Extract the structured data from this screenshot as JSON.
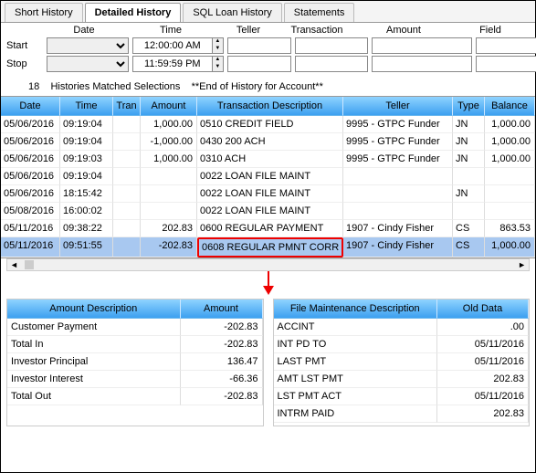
{
  "tabs": [
    {
      "label": "Short History",
      "active": false
    },
    {
      "label": "Detailed History",
      "active": true
    },
    {
      "label": "SQL Loan History",
      "active": false
    },
    {
      "label": "Statements",
      "active": false
    }
  ],
  "filters": {
    "headers": [
      "",
      "Date",
      "Time",
      "Teller",
      "Transaction",
      "Amount",
      "Field"
    ],
    "start_label": "Start",
    "stop_label": "Stop",
    "start_time": "12:00:00 AM",
    "stop_time": "11:59:59 PM"
  },
  "status": {
    "count": "18",
    "text1": "Histories Matched Selections",
    "text2": "**End of History for Account**"
  },
  "grid": {
    "headers": [
      "Date",
      "Time",
      "Tran",
      "Amount",
      "Transaction Description",
      "Teller",
      "Type",
      "Balance"
    ],
    "rows": [
      {
        "date": "05/06/2016",
        "time": "09:19:04",
        "tran": "",
        "amount": "1,000.00",
        "desc": "0510 CREDIT FIELD",
        "teller": "9995 - GTPC Funder",
        "type": "JN",
        "balance": "1,000.00"
      },
      {
        "date": "05/06/2016",
        "time": "09:19:04",
        "tran": "",
        "amount": "-1,000.00",
        "desc": "0430 200 ACH",
        "teller": "9995 - GTPC Funder",
        "type": "JN",
        "balance": "1,000.00"
      },
      {
        "date": "05/06/2016",
        "time": "09:19:03",
        "tran": "",
        "amount": "1,000.00",
        "desc": "0310 ACH",
        "teller": "9995 - GTPC Funder",
        "type": "JN",
        "balance": "1,000.00"
      },
      {
        "date": "05/06/2016",
        "time": "09:19:04",
        "tran": "",
        "amount": "",
        "desc": "0022 LOAN FILE MAINT",
        "teller": "",
        "type": "",
        "balance": ""
      },
      {
        "date": "05/06/2016",
        "time": "18:15:42",
        "tran": "",
        "amount": "",
        "desc": "0022 LOAN FILE MAINT",
        "teller": "",
        "type": "JN",
        "balance": ""
      },
      {
        "date": "05/08/2016",
        "time": "16:00:02",
        "tran": "",
        "amount": "",
        "desc": "0022 LOAN FILE MAINT",
        "teller": "",
        "type": "",
        "balance": ""
      },
      {
        "date": "05/11/2016",
        "time": "09:38:22",
        "tran": "",
        "amount": "202.83",
        "desc": "0600 REGULAR PAYMENT",
        "teller": "1907 - Cindy Fisher",
        "type": "CS",
        "balance": "863.53"
      },
      {
        "date": "05/11/2016",
        "time": "09:51:55",
        "tran": "",
        "amount": "-202.83",
        "desc": "0608 REGULAR PMNT CORR",
        "teller": "1907 - Cindy Fisher",
        "type": "CS",
        "balance": "1,000.00",
        "highlight": true,
        "box": true
      }
    ]
  },
  "left_panel": {
    "headers": [
      "Amount Description",
      "Amount"
    ],
    "rows": [
      {
        "desc": "Customer Payment",
        "amount": "-202.83"
      },
      {
        "desc": "Total In",
        "amount": "-202.83"
      },
      {
        "desc": "Investor Principal",
        "amount": "136.47"
      },
      {
        "desc": "Investor Interest",
        "amount": "-66.36"
      },
      {
        "desc": "Total Out",
        "amount": "-202.83"
      }
    ]
  },
  "right_panel": {
    "headers": [
      "File Maintenance Description",
      "Old Data"
    ],
    "rows": [
      {
        "desc": "ACCINT",
        "data": ".00"
      },
      {
        "desc": "INT PD TO",
        "data": "05/11/2016"
      },
      {
        "desc": "LAST PMT",
        "data": "05/11/2016"
      },
      {
        "desc": "AMT LST PMT",
        "data": "202.83"
      },
      {
        "desc": "LST PMT ACT",
        "data": "05/11/2016"
      },
      {
        "desc": "INTRM PAID",
        "data": "202.83"
      }
    ]
  }
}
